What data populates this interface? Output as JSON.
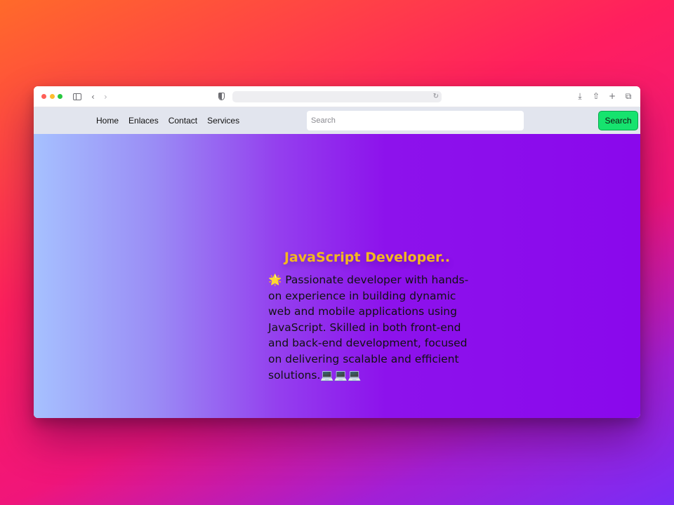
{
  "browser": {
    "url": "",
    "icons": {
      "sidebar": "sidebar-icon",
      "back": "chevron-left-icon",
      "forward": "chevron-right-icon",
      "shield": "shield-icon",
      "reload": "reload-icon",
      "download": "download-icon",
      "share": "share-icon",
      "new_tab": "plus-icon",
      "tabs": "tabs-overview-icon"
    }
  },
  "navbar": {
    "links": [
      "Home",
      "Enlaces",
      "Contact",
      "Services"
    ],
    "search": {
      "placeholder": "Search",
      "value": ""
    },
    "search_button": "Search"
  },
  "hero": {
    "title": "JavaScript Developer..",
    "description": "🌟 Passionate developer with hands-on experience in building dynamic web and mobile applications using JavaScript. Skilled in both front-end and back-end development, focused on delivering scalable and efficient solutions.💻💻💻"
  },
  "colors": {
    "title": "#f4b81f",
    "search_button": "#16e36e",
    "navbar": "#e2e5ee",
    "hero_start": "#a6c1ff",
    "hero_end": "#8a08ec"
  }
}
